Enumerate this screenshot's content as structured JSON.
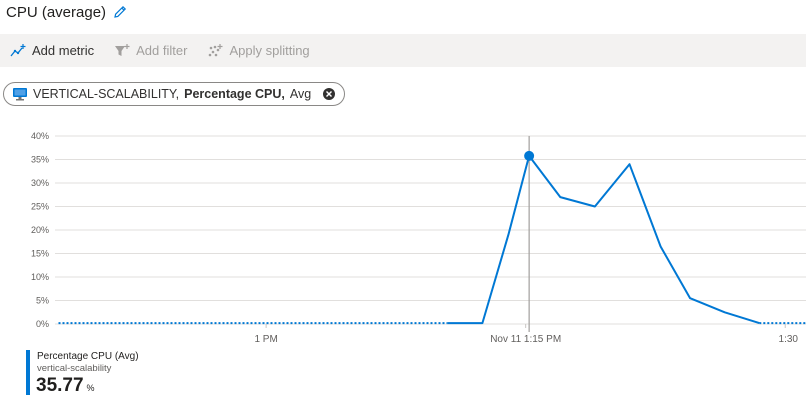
{
  "header": {
    "title": "CPU (average)",
    "edit_icon": "pencil-icon"
  },
  "toolbar": {
    "items": [
      {
        "label": "Add metric",
        "icon": "add-metric-icon",
        "enabled": true
      },
      {
        "label": "Add filter",
        "icon": "filter-icon",
        "enabled": false
      },
      {
        "label": "Apply splitting",
        "icon": "splitting-icon",
        "enabled": false
      }
    ]
  },
  "metric_pill": {
    "resource": "VERTICAL-SCALABILITY,",
    "metric": "Percentage CPU,",
    "aggregation": "Avg",
    "icon": "virtual-machine-icon",
    "close_icon": "close-icon"
  },
  "legend": {
    "metric_name": "Percentage CPU (Avg)",
    "resource": "vertical-scalability",
    "value": "35.77",
    "unit": "%"
  },
  "colors": {
    "series": "#0078d4",
    "accent": "#0078d4",
    "cursor": "#a19f9d",
    "grid": "#e1dfdd"
  },
  "chart_data": {
    "type": "line",
    "y_tick_labels": [
      "0%",
      "5%",
      "10%",
      "15%",
      "20%",
      "25%",
      "30%",
      "35%",
      "40%"
    ],
    "ylim": [
      0,
      40
    ],
    "x_tick_labels": [
      "1 PM",
      "Nov 11 1:15 PM",
      "1:30"
    ],
    "x_ticks_minutes": [
      60,
      75,
      90
    ],
    "xlim_minutes": [
      47.8,
      91.2
    ],
    "cursor_x_minutes": 75.2,
    "cursor_value": 35.77,
    "series": [
      {
        "name": "Percentage CPU (Avg)",
        "color": "#0078d4",
        "segments": [
          {
            "style": "dotted",
            "points": [
              [
                48.0,
                0.2
              ],
              [
                70.5,
                0.2
              ]
            ]
          },
          {
            "style": "solid",
            "points": [
              [
                70.5,
                0.2
              ],
              [
                72.5,
                0.2
              ],
              [
                74.0,
                19.0
              ],
              [
                75.2,
                35.77
              ],
              [
                77.0,
                27.0
              ],
              [
                79.0,
                25.0
              ],
              [
                81.0,
                34.0
              ],
              [
                82.8,
                16.5
              ],
              [
                84.5,
                5.5
              ],
              [
                86.5,
                2.5
              ],
              [
                88.5,
                0.2
              ]
            ]
          },
          {
            "style": "dotted",
            "points": [
              [
                88.5,
                0.2
              ],
              [
                91.2,
                0.2
              ]
            ]
          }
        ]
      }
    ]
  }
}
